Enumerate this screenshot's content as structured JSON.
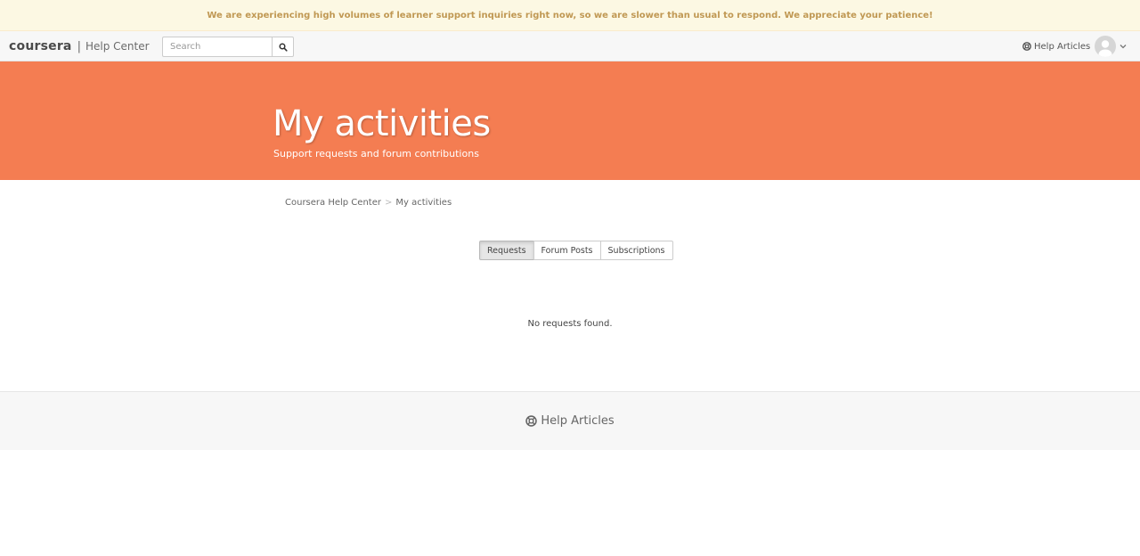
{
  "notice": {
    "text": "We are experiencing high volumes of learner support inquiries right now, so we are slower than usual to respond. We appreciate your patience!"
  },
  "header": {
    "logo": "coursera",
    "separator": "|",
    "help_center": "Help Center",
    "search": {
      "placeholder": "Search",
      "value": ""
    },
    "help_articles_label": "Help Articles",
    "icons": {
      "search": "search-icon",
      "help": "lifebuoy-icon",
      "avatar": "user-avatar-icon",
      "caret": "chevron-down-icon"
    }
  },
  "hero": {
    "title": "My activities",
    "subtitle": "Support requests and forum contributions",
    "background_color": "#f47d52"
  },
  "breadcrumb": {
    "items": [
      "Coursera Help Center",
      "My activities"
    ],
    "separator": ">"
  },
  "tabs": {
    "items": [
      "Requests",
      "Forum Posts",
      "Subscriptions"
    ],
    "selected": "Requests"
  },
  "content": {
    "empty_message": "No requests found."
  },
  "footer": {
    "help_articles_label": "Help Articles"
  }
}
